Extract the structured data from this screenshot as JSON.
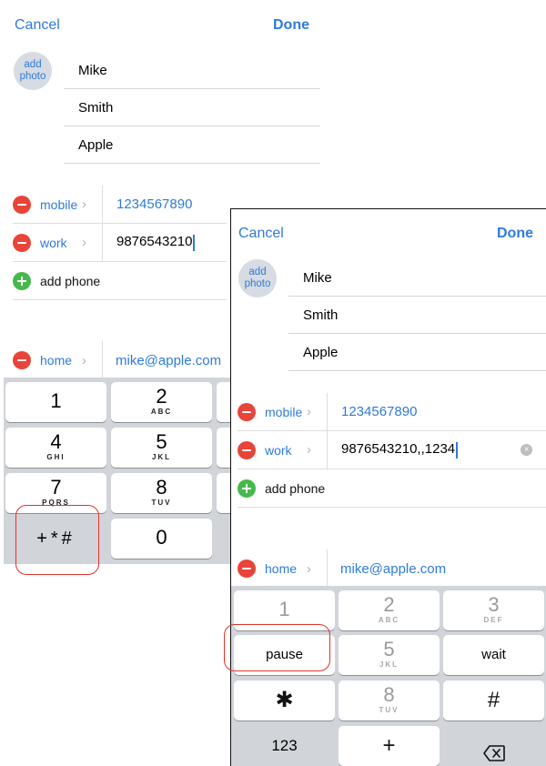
{
  "left": {
    "nav": {
      "cancel": "Cancel",
      "done": "Done"
    },
    "avatar": {
      "line1": "add",
      "line2": "photo"
    },
    "name_fields": [
      "Mike",
      "Smith",
      "Apple"
    ],
    "phones": [
      {
        "label": "mobile",
        "value": "1234567890"
      },
      {
        "label": "work",
        "value": "9876543210"
      }
    ],
    "add_phone": "add phone",
    "email": {
      "label": "home",
      "value": "mike@apple.com"
    },
    "keypad": [
      {
        "num": "1",
        "letters": ""
      },
      {
        "num": "2",
        "letters": "ABC"
      },
      {
        "num": "4",
        "letters": "GHI"
      },
      {
        "num": "5",
        "letters": "JKL"
      },
      {
        "num": "7",
        "letters": "PQRS"
      },
      {
        "num": "8",
        "letters": "TUV"
      },
      {
        "num": "+*#",
        "letters": ""
      },
      {
        "num": "0",
        "letters": ""
      }
    ]
  },
  "right": {
    "nav": {
      "cancel": "Cancel",
      "done": "Done"
    },
    "avatar": {
      "line1": "add",
      "line2": "photo"
    },
    "name_fields": [
      "Mike",
      "Smith",
      "Apple"
    ],
    "phones": [
      {
        "label": "mobile",
        "value": "1234567890"
      },
      {
        "label": "work",
        "value": "9876543210,,1234"
      }
    ],
    "add_phone": "add phone",
    "email": {
      "label": "home",
      "value": "mike@apple.com"
    },
    "keypad": {
      "row1": [
        {
          "num": "1",
          "letters": ""
        },
        {
          "num": "2",
          "letters": "ABC"
        },
        {
          "num": "3",
          "letters": "DEF"
        }
      ],
      "row2": [
        {
          "word": "pause"
        },
        {
          "num": "5",
          "letters": "JKL"
        },
        {
          "word": "wait"
        }
      ],
      "row3": [
        {
          "sym": "✱"
        },
        {
          "num": "8",
          "letters": "TUV"
        },
        {
          "sym": "#"
        }
      ],
      "row4": [
        {
          "word": "123"
        },
        {
          "sym": "+"
        },
        {
          "icon": "backspace-icon"
        }
      ]
    }
  },
  "colors": {
    "accent": "#2f7bd9",
    "delete": "#e8443a",
    "add": "#46b84c",
    "highlight": "#e0322b",
    "keyboard_bg": "#d1d4d9"
  }
}
